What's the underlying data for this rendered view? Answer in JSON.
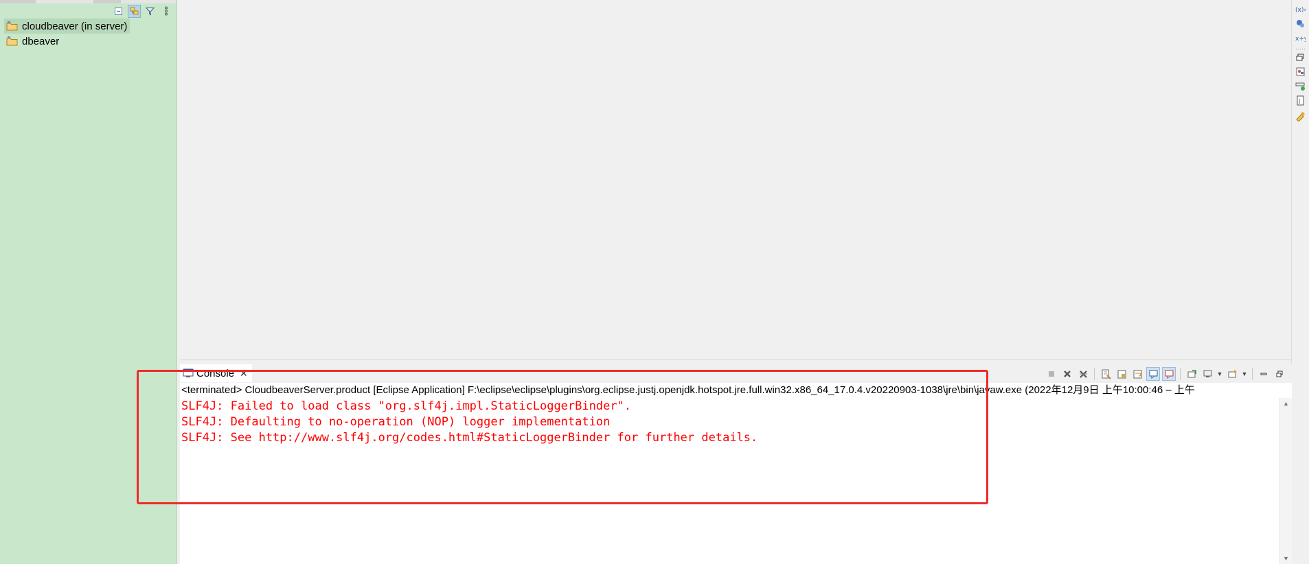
{
  "project_explorer": {
    "items": [
      {
        "label": "cloudbeaver (in server)",
        "selected": true
      },
      {
        "label": "dbeaver",
        "selected": false
      }
    ],
    "toolbar": [
      "collapse-all-icon",
      "link-with-editor-icon",
      "filter-icon",
      "view-menu-icon"
    ]
  },
  "console": {
    "tab_label": "Console",
    "tab_close": "✕",
    "description": "<terminated> CloudbeaverServer.product [Eclipse Application] F:\\eclipse\\eclipse\\plugins\\org.eclipse.justj.openjdk.hotspot.jre.full.win32.x86_64_17.0.4.v20220903-1038\\jre\\bin\\javaw.exe  (2022年12月9日 上午10:00:46 – 上午",
    "output_lines": [
      "SLF4J: Failed to load class \"org.slf4j.impl.StaticLoggerBinder\".",
      "SLF4J: Defaulting to no-operation (NOP) logger implementation",
      "SLF4J: See http://www.slf4j.org/codes.html#StaticLoggerBinder for further details."
    ],
    "output_color": "#ff0000"
  },
  "colors": {
    "explorer_background": "#c9e8cb",
    "highlight_box": "#f02a2a"
  }
}
